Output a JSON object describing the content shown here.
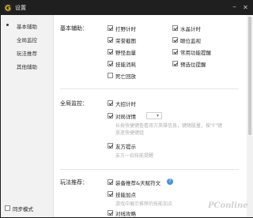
{
  "window": {
    "title": "设置",
    "minimize": "–",
    "close": "✕"
  },
  "sidebar": {
    "items": [
      {
        "label": "基本辅助"
      },
      {
        "label": "全局监控"
      },
      {
        "label": "玩法推荐"
      },
      {
        "label": "其他辅助"
      }
    ],
    "sync_label": "同步模式"
  },
  "basic": {
    "title": "基本辅助：",
    "options": [
      {
        "label": "打野计时"
      },
      {
        "label": "水晶计时"
      },
      {
        "label": "荣誉截图"
      },
      {
        "label": "眼位监视"
      },
      {
        "label": "野怪血量"
      },
      {
        "label": "常用功能提醒"
      },
      {
        "label": "技能消耗"
      },
      {
        "label": "预选位提醒"
      },
      {
        "label": "死亡回放"
      }
    ]
  },
  "monitor": {
    "title": "全局监控：",
    "options": [
      {
        "label": "大招计时"
      },
      {
        "label": "对局详情"
      },
      {
        "label": "友方提示"
      }
    ],
    "detail_select_value": "",
    "detail_hint": "长按快捷键查看双方英雄信息，键随股量，按\"F\"键",
    "detail_hint2": "放逐快捷键组",
    "ally_hint": "友方一招技能提醒"
  },
  "recommend": {
    "title": "玩法推荐：",
    "options": [
      {
        "label": "装备推荐&天赋符文"
      },
      {
        "label": "技能加点"
      },
      {
        "label": "对线攻略"
      }
    ],
    "skill_hint": "游戏中展示推荐的技能加点"
  },
  "icons": {
    "logo": "logo-icon",
    "help": "question-icon"
  },
  "watermark": "PConline"
}
